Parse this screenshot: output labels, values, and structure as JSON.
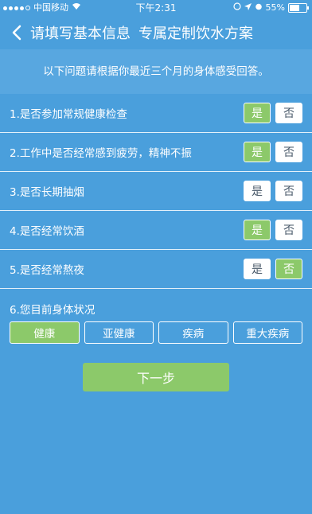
{
  "status_bar": {
    "carrier": "中国移动",
    "time": "下午2:31",
    "battery": "55%"
  },
  "nav": {
    "title": "请填写基本信息",
    "subtitle": "专属定制饮水方案"
  },
  "intro": "以下问题请根据你最近三个月的身体感受回答。",
  "questions": [
    {
      "text": "1.是否参加常规健康检查",
      "yes": "是",
      "no": "否",
      "selected": "yes"
    },
    {
      "text": "2.工作中是否经常感到疲劳，精神不振",
      "yes": "是",
      "no": "否",
      "selected": "yes"
    },
    {
      "text": "3.是否长期抽烟",
      "yes": "是",
      "no": "否",
      "selected": "none"
    },
    {
      "text": "4.是否经常饮酒",
      "yes": "是",
      "no": "否",
      "selected": "yes"
    },
    {
      "text": "5.是否经常熬夜",
      "yes": "是",
      "no": "否",
      "selected": "no"
    }
  ],
  "health_status": {
    "label": "6.您目前身体状况",
    "options": [
      "健康",
      "亚健康",
      "疾病",
      "重大疾病"
    ],
    "selected": 0
  },
  "next_button": "下一步",
  "colors": {
    "background": "#4a9fdc",
    "intro_band": "#58a7e0",
    "selected_green": "#8cc96a"
  }
}
